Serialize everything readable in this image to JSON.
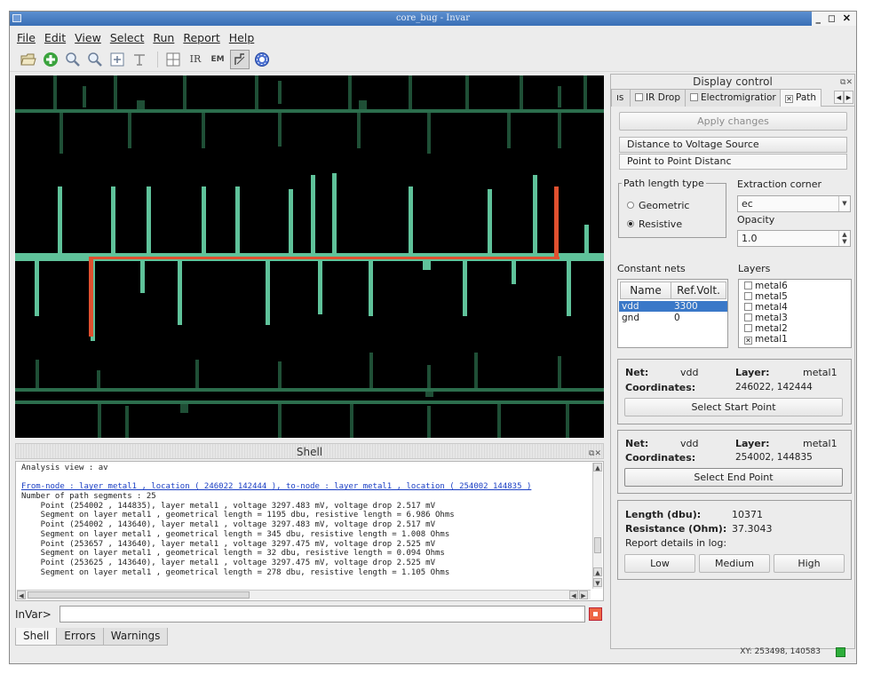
{
  "window": {
    "title": "core_bug - Invar"
  },
  "menubar": [
    "File",
    "Edit",
    "View",
    "Select",
    "Run",
    "Report",
    "Help"
  ],
  "toolbar": {
    "ir_label": "IR",
    "em_label": "EM"
  },
  "colors": {
    "wire": "#5fc29a",
    "path": "#e0502f",
    "selection": "#3a78c8",
    "led": "#2dae3a"
  },
  "shell": {
    "title": "Shell",
    "lines": [
      "Analysis view : av",
      "",
      "From-node : layer metal1 , location ( 246022 142444 ), to-node : layer metal1 , location ( 254002 144835 )",
      "Number of path segments : 25",
      "    Point (254002 , 144835), layer metal1 , voltage 3297.483 mV, voltage drop 2.517 mV",
      "    Segment on layer metal1 , geometrical length = 1195 dbu, resistive length = 6.986 Ohms",
      "    Point (254002 , 143640), layer metal1 , voltage 3297.483 mV, voltage drop 2.517 mV",
      "    Segment on layer metal1 , geometrical length = 345 dbu, resistive length = 1.008 Ohms",
      "    Point (253657 , 143640), layer metal1 , voltage 3297.475 mV, voltage drop 2.525 mV",
      "    Segment on layer metal1 , geometrical length = 32 dbu, resistive length = 0.094 Ohms",
      "    Point (253625 , 143640), layer metal1 , voltage 3297.475 mV, voltage drop 2.525 mV",
      "    Segment on layer metal1 , geometrical length = 278 dbu, resistive length = 1.105 Ohms"
    ],
    "prompt_label": "InVar>",
    "input_value": "",
    "tabs": [
      "Shell",
      "Errors",
      "Warnings"
    ]
  },
  "display_control": {
    "title": "Display control",
    "tabs": [
      {
        "label": "ıs",
        "checked": false,
        "active": false
      },
      {
        "label": "IR Drop",
        "checked": false,
        "active": false
      },
      {
        "label": "Electromigratior",
        "checked": false,
        "active": false
      },
      {
        "label": "Path",
        "checked": true,
        "active": true
      }
    ],
    "apply_button": "Apply changes",
    "modes": [
      "Distance to Voltage Sourcе",
      "Point to Point Distanc"
    ],
    "path_length_type": {
      "title": "Path length type",
      "options": [
        "Geometric",
        "Resistive"
      ],
      "selected": "Resistive"
    },
    "extraction_corner": {
      "label": "Extraction corner",
      "value": "ec"
    },
    "opacity": {
      "label": "Opacity",
      "value": "1.0"
    },
    "constant_nets": {
      "label": "Constant nets",
      "headers": [
        "Name",
        "Ref.Volt."
      ],
      "rows": [
        {
          "name": "vdd",
          "volt": "3300"
        },
        {
          "name": "gnd",
          "volt": "0"
        }
      ]
    },
    "layers": {
      "label": "Layers",
      "items": [
        {
          "name": "metal6",
          "checked": false
        },
        {
          "name": "metal5",
          "checked": false
        },
        {
          "name": "metal4",
          "checked": false
        },
        {
          "name": "metal3",
          "checked": false
        },
        {
          "name": "metal2",
          "checked": false
        },
        {
          "name": "metal1",
          "checked": true
        }
      ]
    },
    "start_point": {
      "net_label": "Net:",
      "net": "vdd",
      "layer_label": "Layer:",
      "layer": "metal1",
      "coords_label": "Coordinates:",
      "coords": "246022, 142444",
      "button": "Select Start Point"
    },
    "end_point": {
      "net_label": "Net:",
      "net": "vdd",
      "layer_label": "Layer:",
      "layer": "metal1",
      "coords_label": "Coordinates:",
      "coords": "254002, 144835",
      "button": "Select End Point"
    },
    "result": {
      "length_label": "Length (dbu):",
      "length": "10371",
      "resistance_label": "Resistance (Ohm):",
      "resistance": "37.3043",
      "report_label": "Report details in log:",
      "buttons": [
        "Low",
        "Medium",
        "High"
      ]
    }
  },
  "status": {
    "xy": "XY: 253498, 140583"
  }
}
